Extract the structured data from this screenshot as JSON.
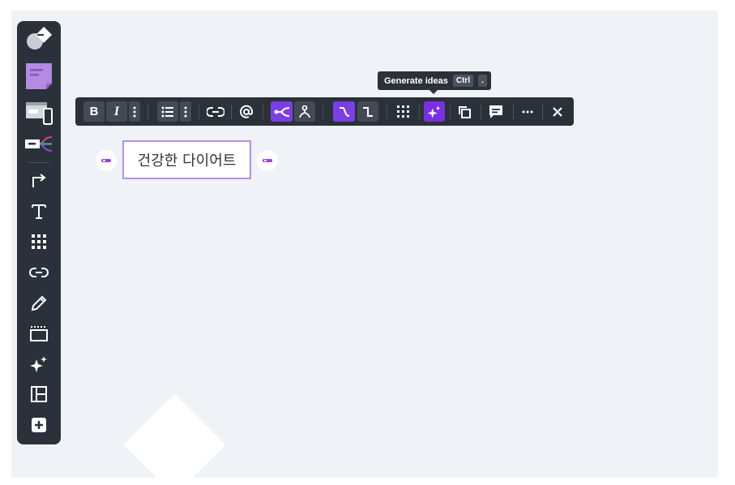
{
  "tooltip": {
    "label": "Generate ideas",
    "key1": "Ctrl",
    "key2": "."
  },
  "node": {
    "text": "건강한 다이어트"
  },
  "floating_toolbar": {
    "bold_label": "B",
    "italic_label": "I"
  },
  "sidebar": {
    "items": [
      "shapes-icon",
      "sticky-note-icon",
      "wireframe-icon",
      "mindmap-icon",
      "connector-arrow-icon",
      "text-icon",
      "grid-icon",
      "link-icon",
      "pen-icon",
      "frame-icon",
      "ai-sparkle-icon",
      "layout-icon",
      "add-more-icon"
    ]
  },
  "colors": {
    "toolbar_bg": "#2b313a",
    "canvas_bg": "#eff2f6",
    "accent_purple": "#7b3fe4",
    "sticky_note": "#b48ae3",
    "node_border": "#b590e8"
  }
}
